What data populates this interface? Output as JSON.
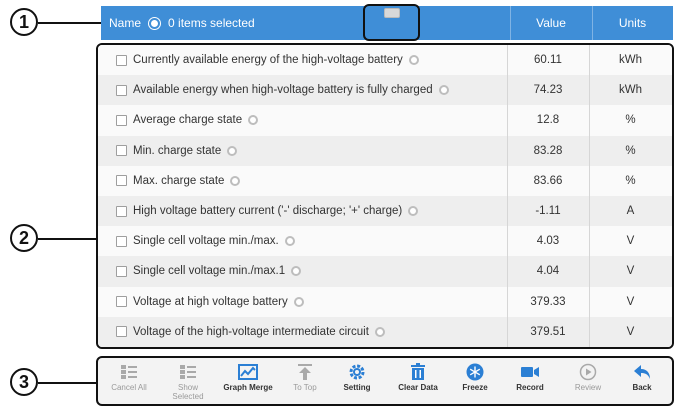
{
  "callouts": [
    "1",
    "2",
    "3"
  ],
  "header": {
    "name_label": "Name",
    "selected_text": "0 items selected",
    "value_label": "Value",
    "units_label": "Units"
  },
  "rows": [
    {
      "name": "Currently available energy of the high-voltage battery",
      "value": "60.11",
      "unit": "kWh"
    },
    {
      "name": "Available energy when high-voltage battery is fully charged",
      "value": "74.23",
      "unit": "kWh"
    },
    {
      "name": "Average charge state",
      "value": "12.8",
      "unit": "%"
    },
    {
      "name": "Min. charge state",
      "value": "83.28",
      "unit": "%"
    },
    {
      "name": "Max. charge state",
      "value": "83.66",
      "unit": "%"
    },
    {
      "name": "High voltage battery current ('-' discharge; '+' charge)",
      "value": "-1.11",
      "unit": "A"
    },
    {
      "name": "Single cell voltage min./max.",
      "value": "4.03",
      "unit": "V"
    },
    {
      "name": "Single cell voltage min./max.1",
      "value": "4.04",
      "unit": "V"
    },
    {
      "name": "Voltage at high voltage battery",
      "value": "379.33",
      "unit": "V"
    },
    {
      "name": "Voltage of the high-voltage intermediate circuit",
      "value": "379.51",
      "unit": "V"
    }
  ],
  "toolbar": [
    {
      "label": "Cancel All",
      "icon": "checklist-icon",
      "enabled": false
    },
    {
      "label": "Show Selected",
      "icon": "checklist-icon",
      "enabled": false
    },
    {
      "label": "Graph Merge",
      "icon": "graph-icon",
      "enabled": true
    },
    {
      "label": "To Top",
      "icon": "arrow-up-icon",
      "enabled": false
    },
    {
      "label": "Setting",
      "icon": "gear-icon",
      "enabled": true
    },
    {
      "label": "Clear Data",
      "icon": "trash-icon",
      "enabled": true
    },
    {
      "label": "Freeze",
      "icon": "snowflake-icon",
      "enabled": true
    },
    {
      "label": "Record",
      "icon": "video-camera-icon",
      "enabled": true
    },
    {
      "label": "Review",
      "icon": "play-icon",
      "enabled": false
    },
    {
      "label": "Back",
      "icon": "back-arrow-icon",
      "enabled": true
    }
  ],
  "colors": {
    "accent": "#3f8ed7",
    "icon_blue": "#2b7fd4",
    "disabled": "#9a9a9a"
  }
}
